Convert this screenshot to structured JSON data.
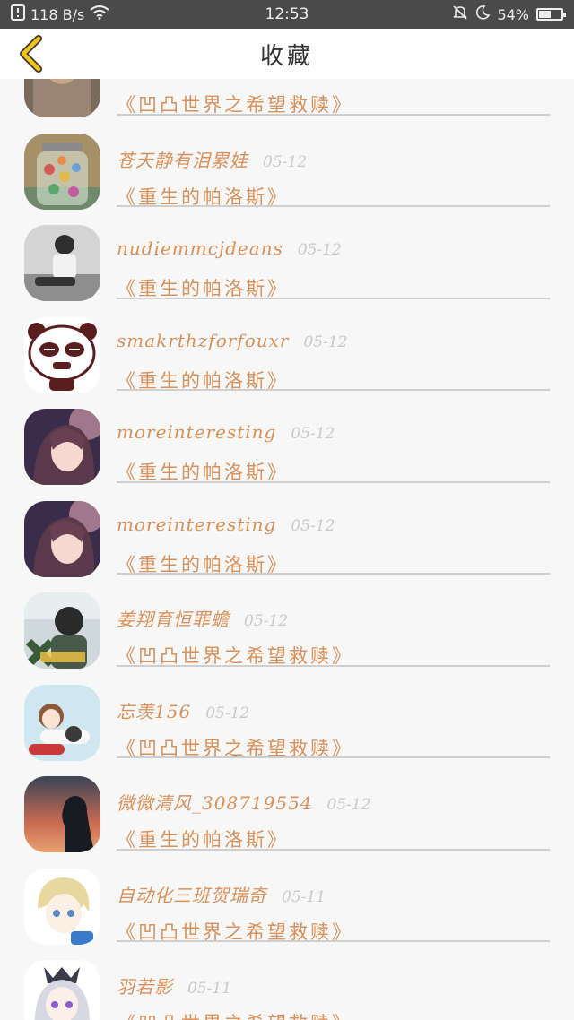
{
  "status_bar": {
    "speed": "118 B/s",
    "time": "12:53",
    "battery": "54%",
    "battery_level": 0.54,
    "icons": [
      "notification-icon",
      "wifi-icon",
      "mute-bell-icon",
      "moon-icon",
      "battery-icon"
    ]
  },
  "header": {
    "title": "收藏",
    "back_icon": "chevron-left-icon",
    "accent": "#f0c419"
  },
  "items": [
    {
      "user": "",
      "date": "",
      "book": "《凹凸世界之希望救赎》",
      "avatar": "avatar-photo"
    },
    {
      "user": "苍天静有泪累娃",
      "date": "05-12",
      "book": "《重生的帕洛斯》",
      "avatar": "avatar-jar"
    },
    {
      "user": "nudiemmcjdeans",
      "date": "05-12",
      "book": "《重生的帕洛斯》",
      "avatar": "avatar-bw-photo"
    },
    {
      "user": "smakrthzforfouxr",
      "date": "05-12",
      "book": "《重生的帕洛斯》",
      "avatar": "avatar-panda"
    },
    {
      "user": "moreinteresting",
      "date": "05-12",
      "book": "《重生的帕洛斯》",
      "avatar": "avatar-anime-girl"
    },
    {
      "user": "moreinteresting",
      "date": "05-12",
      "book": "《重生的帕洛斯》",
      "avatar": "avatar-anime-girl"
    },
    {
      "user": "姜翔育恒罪蟾",
      "date": "05-12",
      "book": "《凹凸世界之希望救赎》",
      "avatar": "avatar-girl-photo"
    },
    {
      "user": "忘羡156",
      "date": "05-12",
      "book": "《凹凸世界之希望救赎》",
      "avatar": "avatar-chibi"
    },
    {
      "user": "微微清风_308719554",
      "date": "05-12",
      "book": "《重生的帕洛斯》",
      "avatar": "avatar-sunset"
    },
    {
      "user": "自动化三班贺瑞奇",
      "date": "05-11",
      "book": "《凹凸世界之希望救赎》",
      "avatar": "avatar-blonde-boy"
    },
    {
      "user": "羽若影",
      "date": "05-11",
      "book": "《凹凸世界之希望救赎》",
      "avatar": "avatar-silver-girl"
    }
  ]
}
